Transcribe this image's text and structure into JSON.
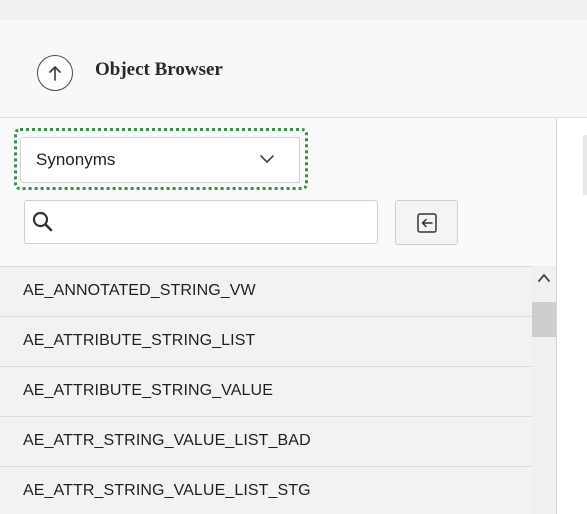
{
  "header": {
    "title": "Object Browser",
    "up_icon": "arrow-up-circle-icon"
  },
  "object_type_select": {
    "selected": "Synonyms",
    "chevron_icon": "chevron-down-icon",
    "focus_color": "#3f8a4f"
  },
  "search": {
    "value": "",
    "placeholder": "",
    "icon": "search-icon"
  },
  "collapse_button": {
    "icon": "collapse-left-icon"
  },
  "list": {
    "items": [
      {
        "label": "AE_ANNOTATED_STRING_VW"
      },
      {
        "label": "AE_ATTRIBUTE_STRING_LIST"
      },
      {
        "label": "AE_ATTRIBUTE_STRING_VALUE"
      },
      {
        "label": "AE_ATTR_STRING_VALUE_LIST_BAD"
      },
      {
        "label": "AE_ATTR_STRING_VALUE_LIST_STG"
      }
    ]
  },
  "scrollbar": {
    "up_icon": "chevron-up-icon"
  }
}
